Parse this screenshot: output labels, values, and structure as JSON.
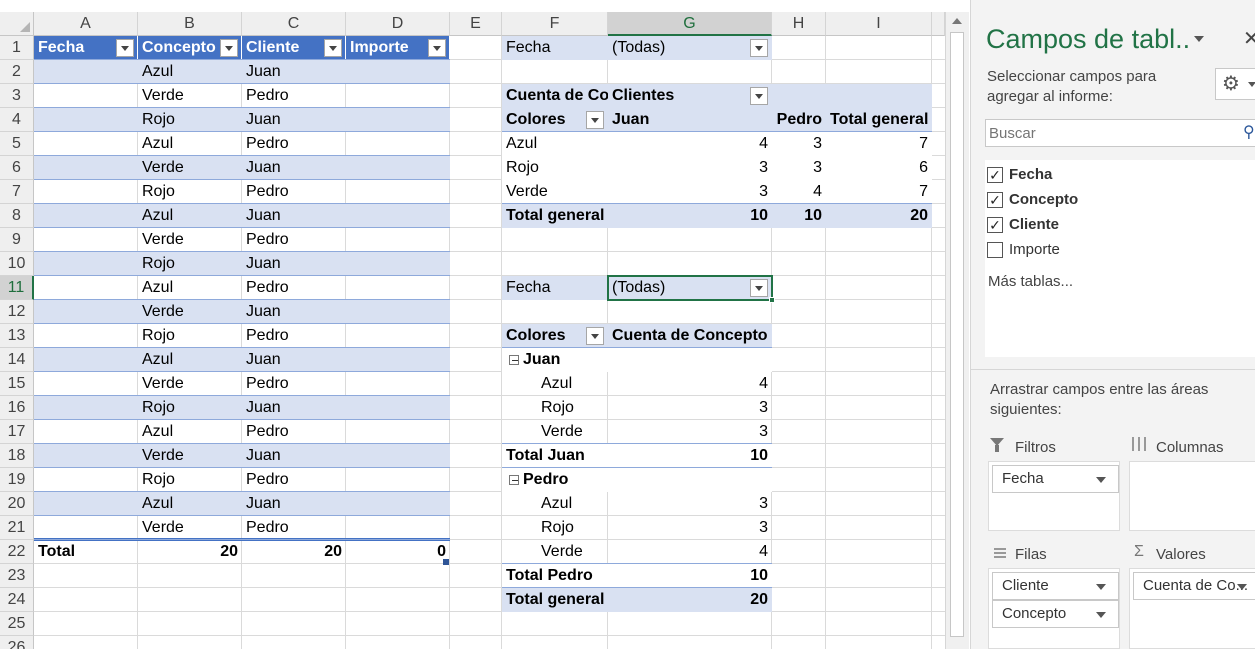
{
  "columns": [
    "A",
    "B",
    "C",
    "D",
    "E",
    "F",
    "G",
    "H",
    "I"
  ],
  "selected_column": "G",
  "rows": [
    "1",
    "2",
    "3",
    "4",
    "5",
    "6",
    "7",
    "8",
    "9",
    "10",
    "11",
    "12",
    "13",
    "14",
    "15",
    "16",
    "17",
    "18",
    "19",
    "20",
    "21",
    "22",
    "23",
    "24",
    "25",
    "26"
  ],
  "selected_row": "11",
  "table": {
    "headers": [
      "Fecha",
      "Concepto",
      "Cliente",
      "Importe"
    ],
    "rows": [
      [
        "Azul",
        "Juan"
      ],
      [
        "Verde",
        "Pedro"
      ],
      [
        "Rojo",
        "Juan"
      ],
      [
        "Azul",
        "Pedro"
      ],
      [
        "Verde",
        "Juan"
      ],
      [
        "Rojo",
        "Pedro"
      ],
      [
        "Azul",
        "Juan"
      ],
      [
        "Verde",
        "Pedro"
      ],
      [
        "Rojo",
        "Juan"
      ],
      [
        "Azul",
        "Pedro"
      ],
      [
        "Verde",
        "Juan"
      ],
      [
        "Rojo",
        "Pedro"
      ],
      [
        "Azul",
        "Juan"
      ],
      [
        "Verde",
        "Pedro"
      ],
      [
        "Rojo",
        "Juan"
      ],
      [
        "Azul",
        "Pedro"
      ],
      [
        "Verde",
        "Juan"
      ],
      [
        "Rojo",
        "Pedro"
      ],
      [
        "Azul",
        "Juan"
      ],
      [
        "Verde",
        "Pedro"
      ]
    ],
    "total_label": "Total",
    "totals": [
      "20",
      "20",
      "0"
    ]
  },
  "pivot1": {
    "filter_label": "Fecha",
    "filter_value": "(Todas)",
    "values_label": "Cuenta de Co",
    "columns_label": "Clientes",
    "rows_label": "Colores",
    "col_headers": [
      "Juan",
      "Pedro",
      "Total general"
    ],
    "rows": [
      {
        "label": "Azul",
        "values": [
          "4",
          "3",
          "7"
        ]
      },
      {
        "label": "Rojo",
        "values": [
          "3",
          "3",
          "6"
        ]
      },
      {
        "label": "Verde",
        "values": [
          "3",
          "4",
          "7"
        ]
      }
    ],
    "total": {
      "label": "Total general",
      "values": [
        "10",
        "10",
        "20"
      ]
    }
  },
  "pivot2": {
    "filter_label": "Fecha",
    "filter_value": "(Todas)",
    "rows_label": "Colores",
    "values_label": "Cuenta de Concepto",
    "groups": [
      {
        "name": "Juan",
        "items": [
          {
            "label": "Azul",
            "value": "4"
          },
          {
            "label": "Rojo",
            "value": "3"
          },
          {
            "label": "Verde",
            "value": "3"
          }
        ],
        "total_label": "Total Juan",
        "total": "10"
      },
      {
        "name": "Pedro",
        "items": [
          {
            "label": "Azul",
            "value": "3"
          },
          {
            "label": "Rojo",
            "value": "3"
          },
          {
            "label": "Verde",
            "value": "4"
          }
        ],
        "total_label": "Total Pedro",
        "total": "10"
      }
    ],
    "grand_label": "Total general",
    "grand_value": "20"
  },
  "pane": {
    "title": "Campos de tabl..",
    "subtitle": "Seleccionar campos para agregar al informe:",
    "search_placeholder": "Buscar",
    "fields": [
      {
        "name": "Fecha",
        "checked": true
      },
      {
        "name": "Concepto",
        "checked": true
      },
      {
        "name": "Cliente",
        "checked": true
      },
      {
        "name": "Importe",
        "checked": false
      }
    ],
    "more_tables": "Más tablas...",
    "drag_hint": "Arrastrar campos entre las áreas siguientes:",
    "areas": {
      "filters_label": "Filtros",
      "columns_label": "Columnas",
      "rows_label": "Filas",
      "values_label": "Valores",
      "filter_chips": [
        "Fecha"
      ],
      "row_chips": [
        "Cliente",
        "Concepto"
      ],
      "value_chips": [
        "Cuenta de Co..."
      ]
    }
  }
}
